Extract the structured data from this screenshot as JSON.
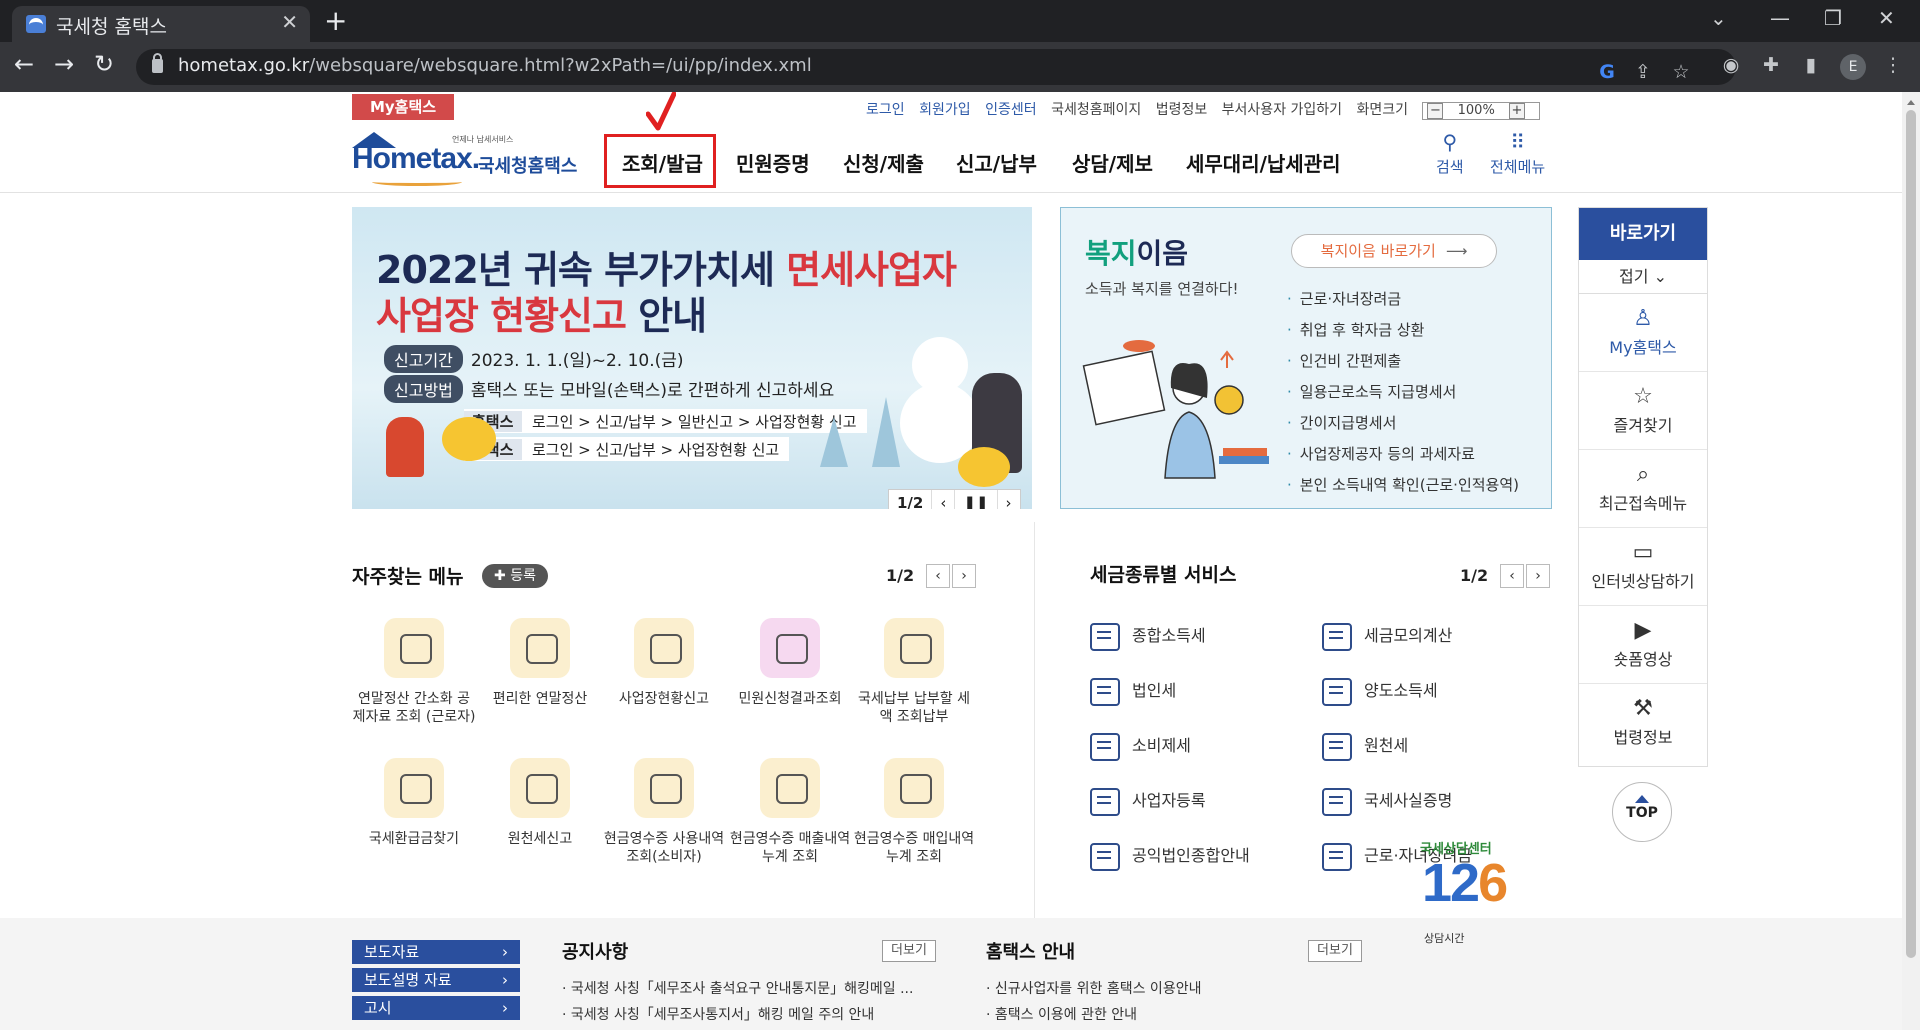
{
  "browser": {
    "tab_title": "국세청 홈택스",
    "url_host": "hometax.go.kr",
    "url_path": "/websquare/websquare.html?w2xPath=/ui/pp/index.xml",
    "profile_initial": "E"
  },
  "header": {
    "my_hometax_tab": "My홈택스",
    "util_links": [
      "로그인",
      "회원가입",
      "인증센터",
      "국세청홈페이지",
      "법령정보",
      "부서사용자 가입하기",
      "화면크기"
    ],
    "zoom": "100%",
    "logo_small": "언제나 납세서비스",
    "logo_main": "Hometax.",
    "logo_kor": "국세청홈택스",
    "gnb": [
      "조회/발급",
      "민원증명",
      "신청/제출",
      "신고/납부",
      "상담/제보",
      "세무대리/납세관리"
    ],
    "gnb_active_index": 0,
    "search_label": "검색",
    "allmenu_label": "전체메뉴"
  },
  "banner": {
    "title_line1_a": "2022년 귀속 부가가치세 ",
    "title_line1_b": "면세사업자",
    "title_line2_a": "사업장 현황신고",
    "title_line2_b": " 안내",
    "period_label": "신고기간",
    "period_value": "2023. 1. 1.(일)~2. 10.(금)",
    "method_label": "신고방법",
    "method_value": "홈택스 또는 모바일(손택스)로 간편하게 신고하세요",
    "path1_label": "홈택스",
    "path1_value": "로그인 > 신고/납부 > 일반신고 > 사업장현황 신고",
    "path2_label": "손택스",
    "path2_value": "로그인 > 신고/납부 > 사업장현황 신고",
    "pager": "1/2"
  },
  "welfare": {
    "title_a": "복지",
    "title_b": "이음",
    "subtitle": "소득과 복지를 연결하다!",
    "button": "복지이음 바로가기",
    "items": [
      "근로·자녀장려금",
      "취업 후 학자금 상환",
      "인건비 간편제출",
      "일용근로소득 지급명세서",
      "간이지급명세서",
      "사업장제공자 등의 과세자료",
      "본인 소득내역 확인(근로·인적용역)"
    ]
  },
  "quick_menu": {
    "title": "바로가기",
    "fold": "접기",
    "items": [
      "My홈택스",
      "즐겨찾기",
      "최근접속메뉴",
      "인터넷상담하기",
      "숏폼영상",
      "법령정보"
    ],
    "top": "TOP"
  },
  "frequent": {
    "title": "자주찾는 메뉴",
    "register": "등록",
    "pager": "1/2",
    "items": [
      "연말정산 간소화 공제자료 조회 (근로자)",
      "편리한 연말정산",
      "사업장현황신고",
      "민원신청결과조회",
      "국세납부 납부할 세액 조회납부",
      "국세환급금찾기",
      "원천세신고",
      "현금영수증 사용내역조회(소비자)",
      "현금영수증 매출내역누계 조회",
      "현금영수증 매입내역누계 조회"
    ]
  },
  "tax_service": {
    "title": "세금종류별 서비스",
    "pager": "1/2",
    "left": [
      "종합소득세",
      "법인세",
      "소비제세",
      "사업자등록",
      "공익법인종합안내"
    ],
    "right": [
      "세금모의계산",
      "양도소득세",
      "원천세",
      "국세사실증명",
      "근로·자녀장려금"
    ]
  },
  "footer": {
    "side_buttons": [
      "보도자료",
      "보도설명 자료",
      "고시"
    ],
    "notice_title": "공지사항",
    "notice_more": "더보기",
    "notices": [
      "국세청 사칭「세무조사 출석요구 안내통지문」해킹메일 ...",
      "국세청 사칭「세무조사통지서」해킹 메일 주의 안내"
    ],
    "guide_title": "홈택스 안내",
    "guide_more": "더보기",
    "guides": [
      "신규사업자를 위한 홈택스 이용안내",
      "홈택스 이용에 관한 안내"
    ],
    "cc_label": "국세상담센터",
    "cc_number_a": "1",
    "cc_number_b": "2",
    "cc_number_c": "6",
    "cc_hours": "상담시간"
  }
}
